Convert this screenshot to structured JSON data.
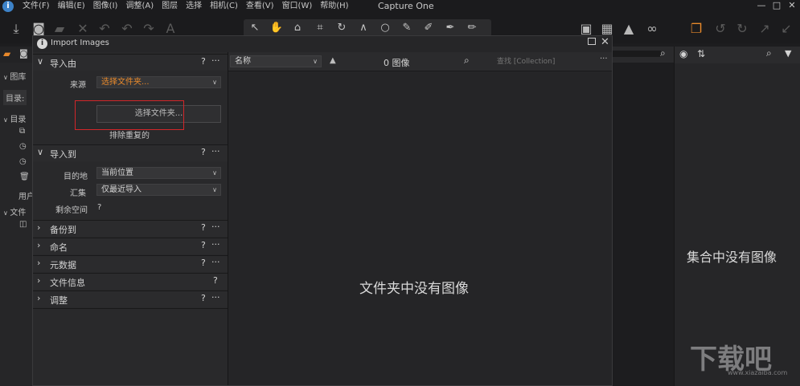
{
  "menubar": {
    "logo": "i",
    "items": [
      "文件(F)",
      "编辑(E)",
      "图像(I)",
      "调整(A)",
      "图层",
      "选择",
      "相机(C)",
      "查看(V)",
      "窗口(W)",
      "帮助(H)"
    ],
    "title": "Capture One",
    "controls": {
      "minimize": "—",
      "maximize": "□",
      "close": "✕"
    }
  },
  "toolbar": {
    "left_icons": [
      "import-icon",
      "camera-icon",
      "folder-icon",
      "delete-icon",
      "undo-icon",
      "undo-all-icon",
      "redo-icon",
      "text-icon"
    ],
    "cursor_tools": [
      "select-icon",
      "pan-icon",
      "loupe-icon",
      "crop-icon",
      "rotate-icon",
      "keystone-icon",
      "spot-icon",
      "brush-icon",
      "eraser-icon",
      "gradient-icon",
      "picker-icon"
    ],
    "right_icons": [
      "proof-icon",
      "grid-icon",
      "warning-icon",
      "glasses-icon",
      "copy-apply-icon",
      "rotate-left-icon",
      "rotate-right-icon",
      "share-icon",
      "export-icon"
    ]
  },
  "left_sidebar": {
    "items": [
      "图库",
      "目录:",
      "目录",
      "用户",
      "文件"
    ]
  },
  "dialog": {
    "title": "Import Images",
    "info": "i",
    "import_from": {
      "title": "导入由",
      "source_label": "来源",
      "source_value": "选择文件夹...",
      "select_folder_button": "选择文件夹...",
      "exclude_duplicates": "排除重复的"
    },
    "import_to": {
      "title": "导入到",
      "destination_label": "目的地",
      "destination_value": "当前位置",
      "collection_label": "汇集",
      "collection_value": "仅最近导入",
      "space_label": "剩余空间",
      "space_value": "?"
    },
    "sections": [
      {
        "title": "备份到",
        "help": "?",
        "more": "···"
      },
      {
        "title": "命名",
        "help": "?",
        "more": "···"
      },
      {
        "title": "元数据",
        "help": "?",
        "more": "···"
      },
      {
        "title": "文件信息",
        "help": "?",
        "more": ""
      },
      {
        "title": "调整",
        "help": "?",
        "more": "···"
      }
    ],
    "help": "?",
    "more": "···",
    "browser": {
      "sort_value": "名称",
      "sort_dir": "▲",
      "image_count": "0 图像",
      "filter_placeholder": "查找 [Collection]",
      "more": "···",
      "empty_message": "文件夹中没有图像"
    }
  },
  "right_pane": {
    "empty_message": "集合中没有图像"
  },
  "watermark": {
    "text": "下载吧",
    "sub": "www.xiazaiba.com"
  }
}
